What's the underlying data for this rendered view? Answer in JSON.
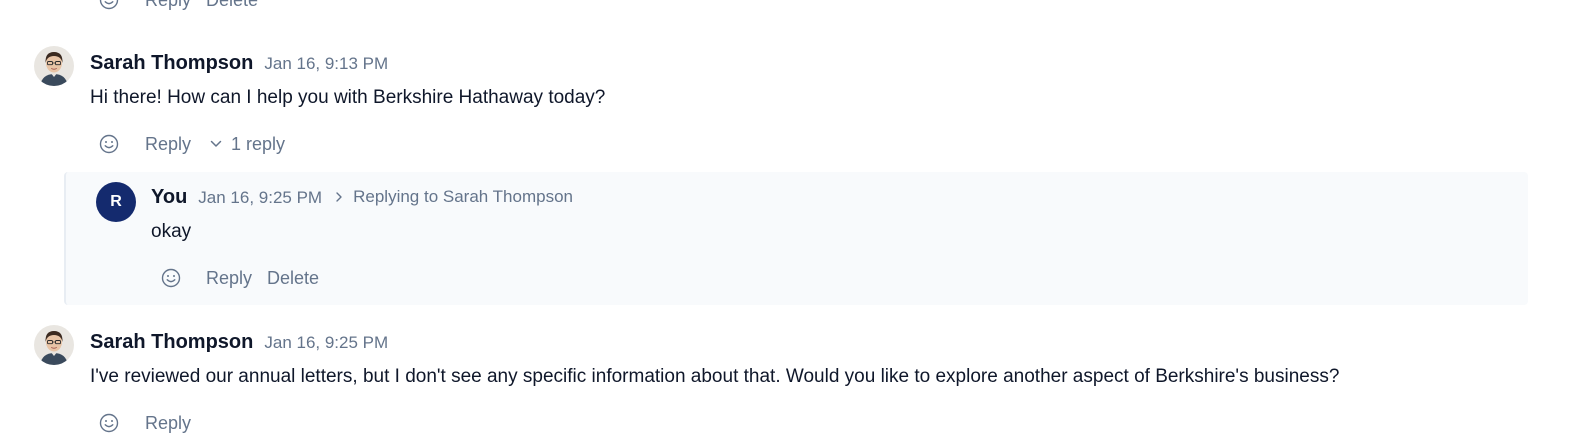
{
  "top_actions": {
    "reply": "Reply",
    "delete": "Delete"
  },
  "messages": [
    {
      "author": "Sarah Thompson",
      "time": "Jan 16, 9:13 PM",
      "text": "Hi there! How can I help you with Berkshire Hathaway today?",
      "actions": {
        "reply": "Reply",
        "thread_toggle": "1 reply"
      }
    },
    {
      "author": "You",
      "avatar_initial": "R",
      "time": "Jan 16, 9:25 PM",
      "replying_to": "Replying to Sarah Thompson",
      "text": "okay",
      "actions": {
        "reply": "Reply",
        "delete": "Delete"
      }
    },
    {
      "author": "Sarah Thompson",
      "time": "Jan 16, 9:25 PM",
      "text": "I've reviewed our annual letters, but I don't see any specific information about that. Would you like to explore another aspect of Berkshire's business?",
      "actions": {
        "reply": "Reply"
      }
    }
  ],
  "icons": {
    "emoji": "smiley-face-icon",
    "chevron_down": "chevron-down-icon",
    "chevron_right": "chevron-right-icon"
  },
  "colors": {
    "user_avatar_bg": "#142a6e",
    "muted_text": "#64748b",
    "reply_panel_bg": "#f8fafc"
  }
}
